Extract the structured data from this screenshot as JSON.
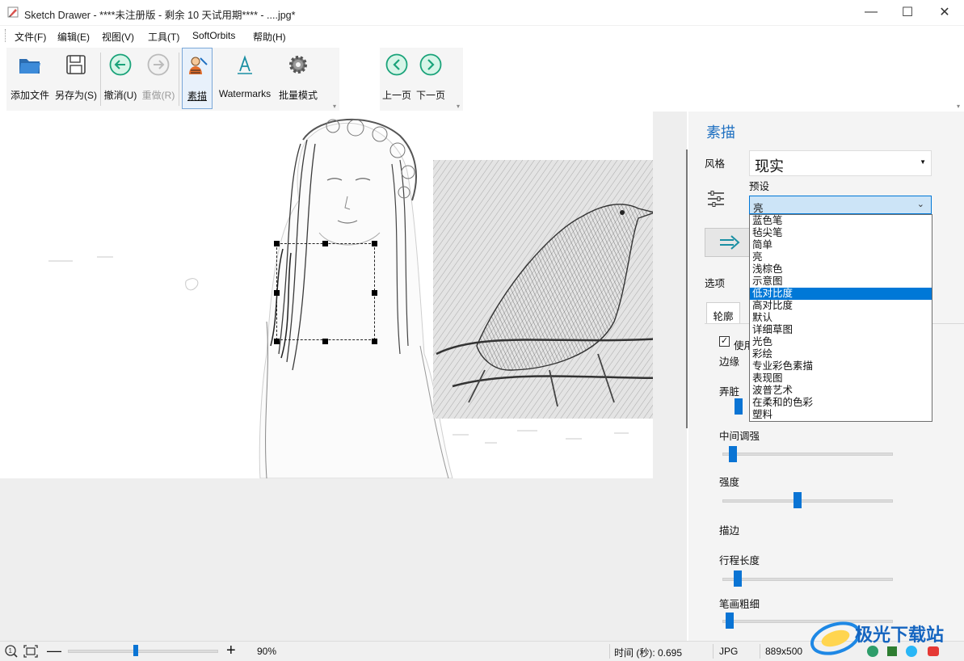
{
  "window": {
    "title": "Sketch Drawer - ****未注册版 - 剩余 10 天试用期**** - ....jpg*",
    "minimize": "—",
    "maximize": "☐",
    "close": "✕"
  },
  "menu": [
    "文件(F)",
    "编辑(E)",
    "视图(V)",
    "工具(T)",
    "SoftOrbits",
    "帮助(H)"
  ],
  "toolbar": {
    "add_file": "添加文件",
    "save_as": "另存为(S)",
    "undo": "撤消(U)",
    "redo": "重做(R)",
    "sketch": "素描",
    "watermarks": "Watermarks",
    "batch": "批量模式",
    "prev_page": "上一页",
    "next_page": "下一页"
  },
  "panel": {
    "title": "素描",
    "style_label": "风格",
    "style_value": "现实",
    "preset_label": "预设",
    "preset_value": "亮",
    "options_label": "选项",
    "tab_outline": "轮廓",
    "use_label": "使用",
    "use_checked": true,
    "edge_label": "边缘",
    "smudge_label": "弄脏",
    "midtone_label": "中间调强",
    "midtone_value": 0.04,
    "strength_label": "强度",
    "strength_value": 0.44,
    "stroke_label": "描边",
    "stroke_length_label": "行程长度",
    "stroke_length_value": 0.07,
    "stroke_width_label": "笔画粗细",
    "stroke_width_value": 0.02
  },
  "preset_options": [
    "蓝色笔",
    "毡尖笔",
    "简单",
    "亮",
    "浅棕色",
    "示意图",
    "低对比度",
    "高对比度",
    "默认",
    "详细草图",
    "光色",
    "彩绘",
    "专业彩色素描",
    "表现图",
    "波普艺术",
    "在柔和的色彩",
    "塑料"
  ],
  "preset_selected_index": 6,
  "status": {
    "zoom": "90%",
    "zoom_fraction": 0.45,
    "time": "时间 (秒): 0.695",
    "format": "JPG",
    "dimensions": "889x500"
  },
  "watermark_text": "极光下载站",
  "colors": {
    "accent": "#0078d7",
    "panel_title": "#1f70c1",
    "nav_green": "#1aa37a"
  }
}
